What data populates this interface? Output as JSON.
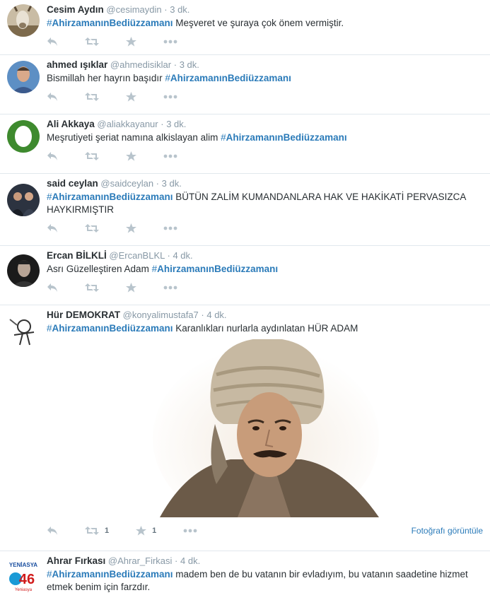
{
  "tweets": [
    {
      "name": "Cesim Aydın",
      "handle": "@cesimaydin",
      "sep": "·",
      "time": "3 dk.",
      "hashtag_pre": "#",
      "hashtag": "AhirzamanınBediüzzamanı",
      "text": " Meşveret ve şuraya çok önem vermiştir.",
      "avatar": "goat-photo"
    },
    {
      "name": "ahmed ışıklar",
      "handle": "@ahmedisiklar",
      "sep": "·",
      "time": "3 dk.",
      "text_before": "Bismillah her hayrın başıdır ",
      "hashtag_pre": "#",
      "hashtag": "AhirzamanınBediüzzamanı",
      "avatar": "man-blue-photo"
    },
    {
      "name": "Ali Akkaya",
      "handle": "@aliakkayanur",
      "sep": "·",
      "time": "3 dk.",
      "text_before": "Meşrutiyeti şeriat namına alkislayan alim  ",
      "hashtag_pre": "#",
      "hashtag": "AhirzamanınBediüzzamanı",
      "avatar": "green-ring"
    },
    {
      "name": "said ceylan",
      "handle": "@saidceylan",
      "sep": "·",
      "time": "3 dk.",
      "hashtag_pre": "#",
      "hashtag": "AhirzamanınBediüzzamanı",
      "text": " BÜTÜN ZALİM KUMANDANLARA HAK VE HAKİKATİ PERVASIZCA HAYKIRMIŞTIR",
      "avatar": "group-photo"
    },
    {
      "name": "Ercan BİLKLİ",
      "handle": "@ErcanBLKL",
      "sep": "·",
      "time": "4 dk.",
      "text_before": "Asrı Güzelleştiren Adam ",
      "hashtag_pre": "#",
      "hashtag": "AhirzamanınBediüzzamanı",
      "avatar": "man-dark-photo"
    },
    {
      "name": "Hür DEMOKRAT",
      "handle": "@konyalimustafa7",
      "sep": "·",
      "time": "4 dk.",
      "hashtag_pre": "#",
      "hashtag": "AhirzamanınBediüzzamanı",
      "text": "  Karanlıkları nurlarla aydınlatan  HÜR ADAM",
      "avatar": "sketch-drawing",
      "retweet_count": "1",
      "favorite_count": "1",
      "view_photo": "Fotoğrafı görüntüle"
    },
    {
      "name": "Ahrar Fırkası",
      "handle": "@Ahrar_Firkasi",
      "sep": "·",
      "time": "4 dk.",
      "hashtag_pre": "#",
      "hashtag": "AhirzamanınBediüzzamanı",
      "text": "  madem ben de bu vatanın bir evladıyım, bu vatanın saadetine hizmet etmek benim için farzdır.",
      "avatar": "yeni-asya-logo"
    }
  ],
  "colors": {
    "link": "#2b7bb9",
    "muted": "#8899a6",
    "icon": "#b8c4cc",
    "border": "#e1e8ed"
  },
  "icons": [
    "reply-icon",
    "retweet-icon",
    "favorite-icon",
    "more-icon"
  ]
}
